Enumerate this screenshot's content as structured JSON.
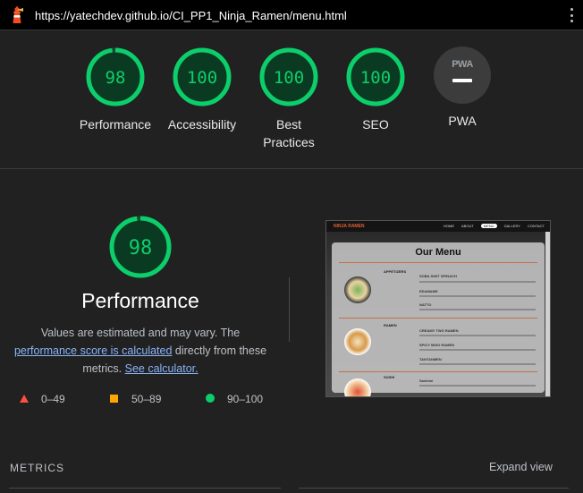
{
  "url_bar": {
    "url": "https://yatechdev.github.io/CI_PP1_Ninja_Ramen/menu.html",
    "logo_icon": "lighthouse-icon",
    "menu_icon": "kebab-menu-icon"
  },
  "colors": {
    "pass": "#0cce6b",
    "average": "#ffa400",
    "fail": "#ff4e42",
    "link": "#8ab4f8"
  },
  "categories": [
    {
      "label": "Performance",
      "score": "98",
      "value": 98
    },
    {
      "label": "Accessibility",
      "score": "100",
      "value": 100
    },
    {
      "label": "Best Practices",
      "score": "100",
      "value": 100
    },
    {
      "label": "SEO",
      "score": "100",
      "value": 100
    },
    {
      "label": "PWA",
      "badge": "PWA"
    }
  ],
  "performance": {
    "score": "98",
    "value": 98,
    "title": "Performance",
    "desc_prefix": "Values are estimated and may vary. The ",
    "desc_link1": "performance score is calculated",
    "desc_middle": " directly from these metrics. ",
    "desc_link2": "See calculator."
  },
  "legend": [
    {
      "range": "0–49",
      "shape": "triangle"
    },
    {
      "range": "50–89",
      "shape": "square"
    },
    {
      "range": "90–100",
      "shape": "circle"
    }
  ],
  "thumbnail": {
    "brand": "NINJA RAMEN",
    "nav": [
      "HOME",
      "ABOUT",
      "MENU",
      "GALLERY",
      "CONTACT"
    ],
    "heading": "Our Menu",
    "sections": [
      "APPETIZERS",
      "RAMEN",
      "SUSHI"
    ],
    "items": [
      "SOBA SHIIT SPINACH",
      "EDAMAME",
      "NATTO",
      "CREAMY TWO RAMEN",
      "SPICY MISO RAMEN",
      "TANTANMEN",
      "Sashimi"
    ]
  },
  "metrics": {
    "label": "METRICS",
    "expand": "Expand view"
  }
}
